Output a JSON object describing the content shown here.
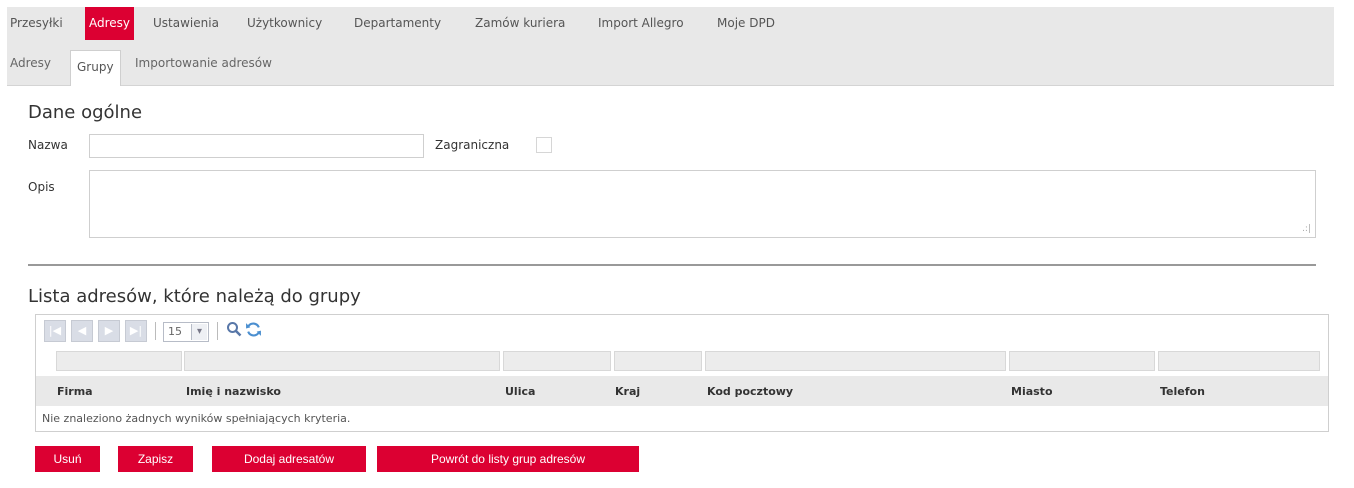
{
  "top_nav": {
    "items": [
      {
        "label": "Przesyłki"
      },
      {
        "label": "Adresy"
      },
      {
        "label": "Ustawienia"
      },
      {
        "label": "Użytkownicy"
      },
      {
        "label": "Departamenty"
      },
      {
        "label": "Zamów kuriera"
      },
      {
        "label": "Import Allegro"
      },
      {
        "label": "Moje DPD"
      }
    ],
    "active": "Adresy"
  },
  "sub_nav": {
    "items": [
      {
        "label": "Adresy"
      },
      {
        "label": "Grupy"
      },
      {
        "label": "Importowanie adresów"
      }
    ],
    "active": "Grupy"
  },
  "general": {
    "title": "Dane ogólne",
    "name_label": "Nazwa",
    "name_value": "",
    "foreign_label": "Zagraniczna",
    "foreign_checked": false,
    "description_label": "Opis",
    "description_value": ""
  },
  "address_list": {
    "title": "Lista adresów, które należą do grupy",
    "page_size": "15",
    "columns": [
      "Firma",
      "Imię i nazwisko",
      "Ulica",
      "Kraj",
      "Kod pocztowy",
      "Miasto",
      "Telefon"
    ],
    "empty_message": "Nie znaleziono żadnych wyników spełniających kryteria."
  },
  "actions": {
    "delete": "Usuń",
    "save": "Zapisz",
    "add_recipients": "Dodaj adresatów",
    "back": "Powrót do listy grup adresów"
  },
  "colors": {
    "accent": "#dc0032",
    "nav_background": "#e8e8e8",
    "table_header": "#e9e9e9"
  }
}
